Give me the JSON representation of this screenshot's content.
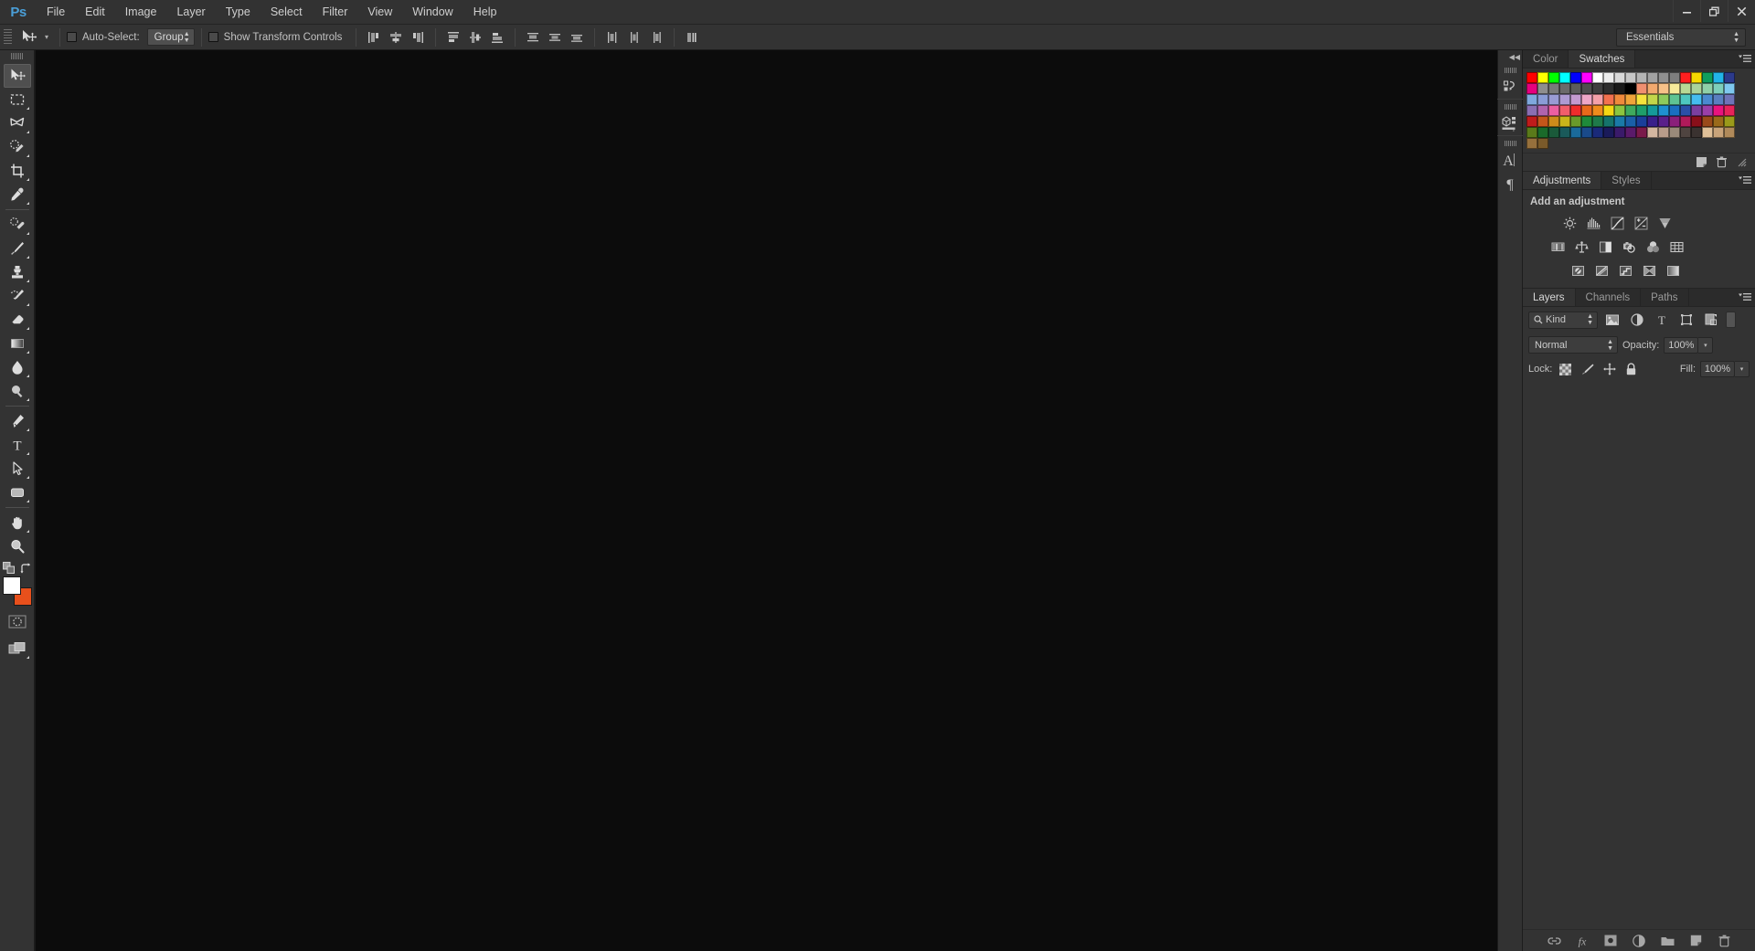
{
  "app": {
    "name": "Adobe Photoshop",
    "logo_text": "Ps",
    "logo_color": "#4a9fd8"
  },
  "menubar": {
    "items": [
      {
        "label": "File"
      },
      {
        "label": "Edit"
      },
      {
        "label": "Image"
      },
      {
        "label": "Layer"
      },
      {
        "label": "Type"
      },
      {
        "label": "Select"
      },
      {
        "label": "Filter"
      },
      {
        "label": "View"
      },
      {
        "label": "Window"
      },
      {
        "label": "Help"
      }
    ]
  },
  "window_controls": {
    "minimize": "minimize-icon",
    "restore": "restore-icon",
    "close": "close-icon"
  },
  "options_bar": {
    "active_tool": "move-tool",
    "auto_select_label": "Auto-Select:",
    "auto_select_checked": false,
    "auto_select_scope": "Group",
    "show_transform_label": "Show Transform Controls",
    "show_transform_checked": false,
    "align_group_1": [
      {
        "name": "align-left-edges-icon"
      },
      {
        "name": "align-horizontal-centers-icon"
      },
      {
        "name": "align-right-edges-icon"
      }
    ],
    "align_group_2": [
      {
        "name": "align-top-edges-icon"
      },
      {
        "name": "align-vertical-centers-icon"
      },
      {
        "name": "align-bottom-edges-icon"
      }
    ],
    "distribute_group_1": [
      {
        "name": "distribute-top-edges-icon"
      },
      {
        "name": "distribute-vertical-centers-icon"
      },
      {
        "name": "distribute-bottom-edges-icon"
      }
    ],
    "distribute_group_2": [
      {
        "name": "distribute-left-edges-icon"
      },
      {
        "name": "distribute-horizontal-centers-icon"
      },
      {
        "name": "distribute-right-edges-icon"
      }
    ],
    "align_extra": [
      {
        "name": "auto-align-layers-icon"
      }
    ],
    "workspace": "Essentials"
  },
  "toolbar": {
    "tools": [
      {
        "name": "move-tool",
        "active": true,
        "has_flyout": false
      },
      {
        "name": "rectangular-marquee-tool",
        "active": false,
        "has_flyout": true
      },
      {
        "name": "lasso-tool",
        "active": false,
        "has_flyout": true
      },
      {
        "name": "quick-selection-tool",
        "active": false,
        "has_flyout": true
      },
      {
        "name": "crop-tool",
        "active": false,
        "has_flyout": true
      },
      {
        "name": "eyedropper-tool",
        "active": false,
        "has_flyout": true
      },
      {
        "name": "spot-healing-brush-tool",
        "active": false,
        "has_flyout": true
      },
      {
        "name": "brush-tool",
        "active": false,
        "has_flyout": true
      },
      {
        "name": "clone-stamp-tool",
        "active": false,
        "has_flyout": true
      },
      {
        "name": "history-brush-tool",
        "active": false,
        "has_flyout": true
      },
      {
        "name": "eraser-tool",
        "active": false,
        "has_flyout": true
      },
      {
        "name": "gradient-tool",
        "active": false,
        "has_flyout": true
      },
      {
        "name": "blur-tool",
        "active": false,
        "has_flyout": true
      },
      {
        "name": "dodge-tool",
        "active": false,
        "has_flyout": true
      },
      {
        "name": "pen-tool",
        "active": false,
        "has_flyout": true
      },
      {
        "name": "type-tool",
        "active": false,
        "has_flyout": true
      },
      {
        "name": "path-selection-tool",
        "active": false,
        "has_flyout": true
      },
      {
        "name": "rectangle-shape-tool",
        "active": false,
        "has_flyout": true
      },
      {
        "name": "hand-tool",
        "active": false,
        "has_flyout": true
      },
      {
        "name": "zoom-tool",
        "active": false,
        "has_flyout": false
      }
    ],
    "default_colors_icon": "default-foreground-background-icon",
    "swap_colors_icon": "swap-foreground-background-icon",
    "foreground_color": "#ffffff",
    "background_color": "#e8501c",
    "quick_mask_icon": "edit-in-quick-mask-mode-icon",
    "screen_mode_icon": "change-screen-mode-icon"
  },
  "icon_dock": {
    "collapse_icon": "collapse-panels-icon",
    "items": [
      {
        "name": "history-panel-icon"
      },
      {
        "name": "properties-3d-panel-icon"
      },
      {
        "name": "character-panel-icon"
      },
      {
        "name": "paragraph-panel-icon"
      }
    ]
  },
  "panels": {
    "color_swatches": {
      "tabs": [
        {
          "label": "Color",
          "active": false
        },
        {
          "label": "Swatches",
          "active": true
        }
      ],
      "menu_icon": "panel-menu-icon",
      "footer": [
        {
          "name": "new-swatch-icon"
        },
        {
          "name": "delete-swatch-icon"
        },
        {
          "name": "resize-grip-icon"
        }
      ],
      "swatch_colors": [
        "#ff0000",
        "#ffff00",
        "#00ff00",
        "#00ffff",
        "#0000ff",
        "#ff00ff",
        "#ffffff",
        "#ececec",
        "#d8d8d8",
        "#c6c6c6",
        "#b4b4b4",
        "#a2a2a2",
        "#909090",
        "#7e7e7e",
        "#ff1f1f",
        "#f5d800",
        "#0f9e5e",
        "#22b4e8",
        "#2c3a8c",
        "#e6007e",
        "#8e8e8e",
        "#7a7a7a",
        "#6a6a6a",
        "#5c5c5c",
        "#4e4e4e",
        "#3f3f3f",
        "#2e2e2e",
        "#1a1a1a",
        "#000000",
        "#f08f70",
        "#f2a96e",
        "#f7c188",
        "#f6ea9a",
        "#b9d995",
        "#a9d39a",
        "#8fd0a8",
        "#7ecfba",
        "#7ec8ef",
        "#7fa8dd",
        "#8a9cd6",
        "#9a9bd4",
        "#ad9bd3",
        "#c49ad0",
        "#eea6c6",
        "#f4a0a8",
        "#f3714f",
        "#f08a3c",
        "#f0a43a",
        "#f5e23c",
        "#c3d64a",
        "#8ecb5c",
        "#5ec493",
        "#4ec7c0",
        "#45bdf0",
        "#4a8ad0",
        "#5a7fc0",
        "#6f73b8",
        "#8a6fb2",
        "#b063ac",
        "#ec5fa0",
        "#f15d6b",
        "#ef2c2c",
        "#e8691b",
        "#ef8b1c",
        "#f5d813",
        "#8cc63f",
        "#3faa5d",
        "#1f9e6a",
        "#159a9a",
        "#1e90d0",
        "#1a6fc0",
        "#2a4fa8",
        "#7b3fa0",
        "#9a3fa8",
        "#e8147e",
        "#e8235a",
        "#c01b1b",
        "#c4561a",
        "#cd8b1a",
        "#c9b51a",
        "#6a9a2a",
        "#1f8a3a",
        "#1f7a4a",
        "#15736b",
        "#1a7aa8",
        "#1a5fa8",
        "#1a3f9a",
        "#3a1f8a",
        "#5a1f8a",
        "#8a1f7a",
        "#b01a5a",
        "#8a0f1a",
        "#9a4a1a",
        "#9a6a1a",
        "#9a9a1a",
        "#5a7a1a",
        "#1a6a2a",
        "#1a5a3a",
        "#1a5a5a",
        "#1a6a9a",
        "#1a4a8a",
        "#1a2a7a",
        "#1a1a5a",
        "#3a1a6a",
        "#5a1a6a",
        "#7a1a4a",
        "#d4b6a0",
        "#b89c8a",
        "#9a8a7a",
        "#4f4440",
        "#3a3230",
        "#e0c098",
        "#c9a47a",
        "#b08a5a",
        "#96703c",
        "#7a5a2a"
      ]
    },
    "adjustments": {
      "tabs": [
        {
          "label": "Adjustments",
          "active": true
        },
        {
          "label": "Styles",
          "active": false
        }
      ],
      "menu_icon": "panel-menu-icon",
      "heading": "Add an adjustment",
      "row1": [
        {
          "name": "brightness-contrast-adjustment-icon"
        },
        {
          "name": "levels-adjustment-icon"
        },
        {
          "name": "curves-adjustment-icon"
        },
        {
          "name": "exposure-adjustment-icon"
        },
        {
          "name": "vibrance-adjustment-icon"
        }
      ],
      "row2": [
        {
          "name": "hue-saturation-adjustment-icon"
        },
        {
          "name": "color-balance-adjustment-icon"
        },
        {
          "name": "black-white-adjustment-icon"
        },
        {
          "name": "photo-filter-adjustment-icon"
        },
        {
          "name": "channel-mixer-adjustment-icon"
        },
        {
          "name": "color-lookup-adjustment-icon"
        }
      ],
      "row3": [
        {
          "name": "invert-adjustment-icon"
        },
        {
          "name": "posterize-adjustment-icon"
        },
        {
          "name": "threshold-adjustment-icon"
        },
        {
          "name": "selective-color-adjustment-icon"
        },
        {
          "name": "gradient-map-adjustment-icon"
        }
      ]
    },
    "layers": {
      "tabs": [
        {
          "label": "Layers",
          "active": true
        },
        {
          "label": "Channels",
          "active": false
        },
        {
          "label": "Paths",
          "active": false
        }
      ],
      "menu_icon": "panel-menu-icon",
      "filter_label": "Kind",
      "filter_icons": [
        {
          "name": "filter-pixel-layers-icon"
        },
        {
          "name": "filter-adjustment-layers-icon"
        },
        {
          "name": "filter-type-layers-icon"
        },
        {
          "name": "filter-shape-layers-icon"
        },
        {
          "name": "filter-smart-object-layers-icon"
        }
      ],
      "filter_toggle": "layer-filter-toggle",
      "blend_mode": "Normal",
      "opacity_label": "Opacity:",
      "opacity_value": "100%",
      "lock_label": "Lock:",
      "lock_buttons": [
        {
          "name": "lock-transparent-pixels-icon"
        },
        {
          "name": "lock-image-pixels-icon"
        },
        {
          "name": "lock-position-icon"
        },
        {
          "name": "lock-all-icon"
        }
      ],
      "fill_label": "Fill:",
      "fill_value": "100%",
      "layer_items": [],
      "footer": [
        {
          "name": "link-layers-icon"
        },
        {
          "name": "add-layer-style-icon"
        },
        {
          "name": "add-layer-mask-icon"
        },
        {
          "name": "new-fill-adjustment-layer-icon"
        },
        {
          "name": "new-group-icon"
        },
        {
          "name": "new-layer-icon"
        },
        {
          "name": "delete-layer-icon"
        }
      ]
    }
  },
  "canvas": {
    "background_color": "#0c0c0c",
    "has_document": false
  }
}
